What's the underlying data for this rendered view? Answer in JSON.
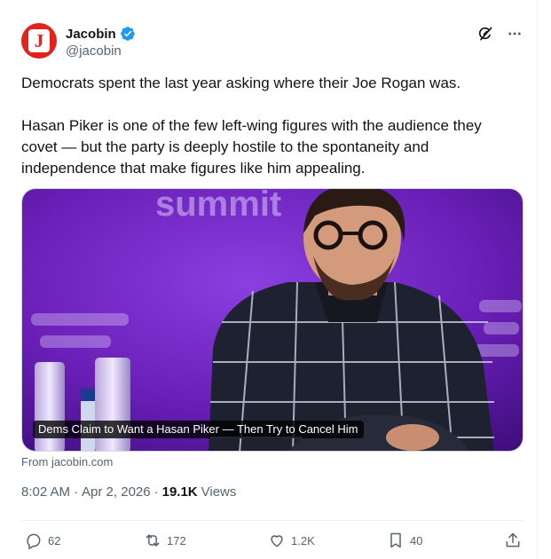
{
  "author": {
    "display_name": "Jacobin",
    "handle": "@jacobin",
    "avatar_letter": "J",
    "brand_color": "#e2231a",
    "verified": true
  },
  "tweet": {
    "paragraphs": [
      "Democrats spent the last year asking where their Joe Rogan was.",
      "Hasan Piker is one of the few left-wing figures with the audience they covet — but the party is deeply hostile to the spontaneity and independence that make figures like him appealing."
    ]
  },
  "card": {
    "caption": "Dems Claim to Want a Hasan Piker — Then Try to Cancel Him",
    "source": "From jacobin.com",
    "background_text": "summit"
  },
  "meta": {
    "time": "8:02 AM",
    "date": "Apr 2, 2026",
    "separator": "·",
    "views_count": "19.1K",
    "views_label": "Views"
  },
  "actions": {
    "replies": "62",
    "reposts": "172",
    "likes": "1.2K",
    "bookmarks": "40"
  },
  "colors": {
    "text_primary": "#0f1419",
    "text_secondary": "#536471",
    "verified_blue": "#1d9bf0",
    "media_purple": "#6a1fb8"
  }
}
